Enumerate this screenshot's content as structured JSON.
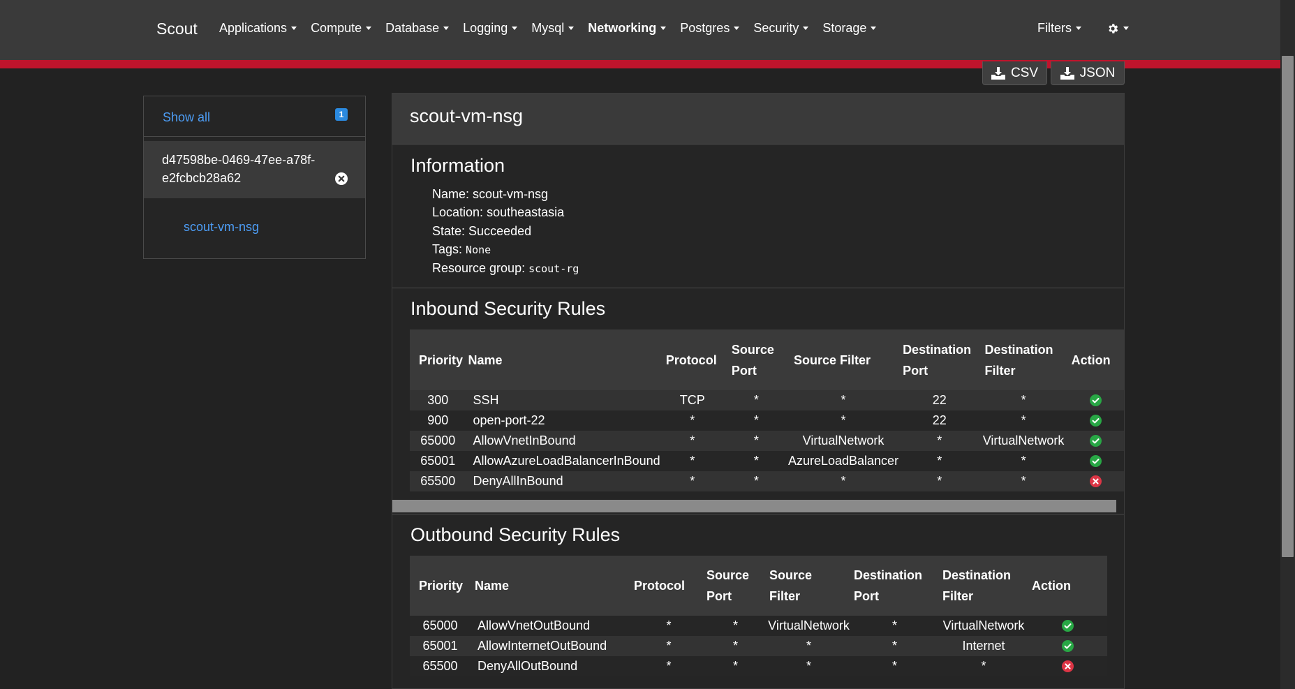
{
  "navbar": {
    "brand": "Scout",
    "items": [
      {
        "label": "Applications",
        "active": false
      },
      {
        "label": "Compute",
        "active": false
      },
      {
        "label": "Database",
        "active": false
      },
      {
        "label": "Logging",
        "active": false
      },
      {
        "label": "Mysql",
        "active": false
      },
      {
        "label": "Networking",
        "active": true
      },
      {
        "label": "Postgres",
        "active": false
      },
      {
        "label": "Security",
        "active": false
      },
      {
        "label": "Storage",
        "active": false
      }
    ],
    "filters_label": "Filters",
    "settings_icon": "gear-icon",
    "accent_color": "#c0142c"
  },
  "export": {
    "csv_label": "CSV",
    "json_label": "JSON"
  },
  "sidebar": {
    "show_all_label": "Show all",
    "count_badge": "1",
    "account_id": "d47598be-0469-47ee-a78f-e2fcbcb28a62",
    "resource_link": "scout-vm-nsg"
  },
  "panel": {
    "title": "scout-vm-nsg",
    "information": {
      "heading": "Information",
      "name_label": "Name:",
      "name_value": "scout-vm-nsg",
      "location_label": "Location:",
      "location_value": "southeastasia",
      "state_label": "State:",
      "state_value": "Succeeded",
      "tags_label": "Tags:",
      "tags_value": "None",
      "rg_label": "Resource group:",
      "rg_value": "scout-rg"
    },
    "inbound": {
      "heading": "Inbound Security Rules",
      "headers": [
        "Priority",
        "Name",
        "Protocol",
        "Source Port",
        "Source Filter",
        "Destination Port",
        "Destination Filter",
        "Action"
      ],
      "rows": [
        {
          "priority": "300",
          "name": "SSH",
          "protocol": "TCP",
          "source_port": "*",
          "source_filter": "*",
          "dest_port": "22",
          "dest_filter": "*",
          "action": "allow"
        },
        {
          "priority": "900",
          "name": "open-port-22",
          "protocol": "*",
          "source_port": "*",
          "source_filter": "*",
          "dest_port": "22",
          "dest_filter": "*",
          "action": "allow"
        },
        {
          "priority": "65000",
          "name": "AllowVnetInBound",
          "protocol": "*",
          "source_port": "*",
          "source_filter": "VirtualNetwork",
          "dest_port": "*",
          "dest_filter": "VirtualNetwork",
          "action": "allow"
        },
        {
          "priority": "65001",
          "name": "AllowAzureLoadBalancerInBound",
          "protocol": "*",
          "source_port": "*",
          "source_filter": "AzureLoadBalancer",
          "dest_port": "*",
          "dest_filter": "*",
          "action": "allow"
        },
        {
          "priority": "65500",
          "name": "DenyAllInBound",
          "protocol": "*",
          "source_port": "*",
          "source_filter": "*",
          "dest_port": "*",
          "dest_filter": "*",
          "action": "deny"
        }
      ]
    },
    "outbound": {
      "heading": "Outbound Security Rules",
      "headers": [
        "Priority",
        "Name",
        "Protocol",
        "Source Port",
        "Source Filter",
        "Destination Port",
        "Destination Filter",
        "Action"
      ],
      "rows": [
        {
          "priority": "65000",
          "name": "AllowVnetOutBound",
          "protocol": "*",
          "source_port": "*",
          "source_filter": "VirtualNetwork",
          "dest_port": "*",
          "dest_filter": "VirtualNetwork",
          "action": "allow"
        },
        {
          "priority": "65001",
          "name": "AllowInternetOutBound",
          "protocol": "*",
          "source_port": "*",
          "source_filter": "*",
          "dest_port": "*",
          "dest_filter": "Internet",
          "action": "allow"
        },
        {
          "priority": "65500",
          "name": "DenyAllOutBound",
          "protocol": "*",
          "source_port": "*",
          "source_filter": "*",
          "dest_port": "*",
          "dest_filter": "*",
          "action": "deny"
        }
      ]
    },
    "colors": {
      "allow": "#28a745",
      "deny": "#dc3545"
    }
  }
}
